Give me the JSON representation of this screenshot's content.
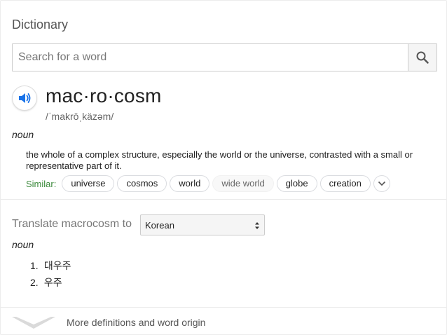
{
  "header": {
    "title": "Dictionary"
  },
  "search": {
    "placeholder": "Search for a word",
    "icon": "search-icon"
  },
  "entry": {
    "headword": "mac·ro·cosm",
    "phonetic": "/ˈmakrōˌkäzəm/",
    "part_of_speech": "noun",
    "definition": "the whole of a complex structure, especially the world or the universe, contrasted with a small or representative part of it.",
    "similar_label": "Similar:",
    "similar": [
      "universe",
      "cosmos",
      "world",
      "wide world",
      "globe",
      "creation"
    ]
  },
  "translate": {
    "label": "Translate macrocosm to",
    "language": "Korean",
    "part_of_speech": "noun",
    "items": [
      {
        "num": "1.",
        "text": "대우주"
      },
      {
        "num": "2.",
        "text": "우주"
      }
    ]
  },
  "footer": {
    "more_label": "More definitions and word origin"
  },
  "colors": {
    "accent_blue": "#1a73e8",
    "similar_green": "#3c8a3c",
    "text": "#222222"
  }
}
